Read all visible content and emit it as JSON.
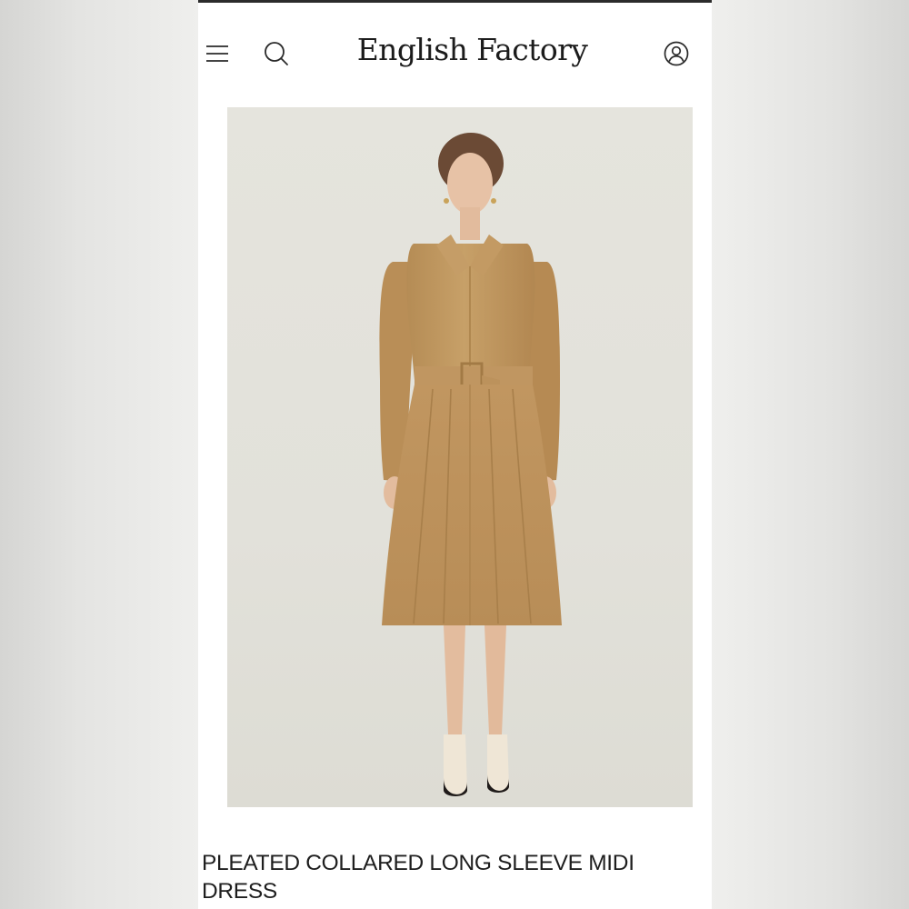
{
  "header": {
    "brand": "English Factory",
    "icons": {
      "menu": "hamburger-menu-icon",
      "search": "search-icon",
      "account": "user-account-icon"
    }
  },
  "product": {
    "image_alt": "Model wearing a camel pleated collared long sleeve midi dress with belt",
    "title": "PLEATED COLLARED LONG SLEEVE MIDI DRESS"
  },
  "colors": {
    "dress": "#c29a62",
    "background": "#e3e2db",
    "text": "#1e1e1e"
  }
}
